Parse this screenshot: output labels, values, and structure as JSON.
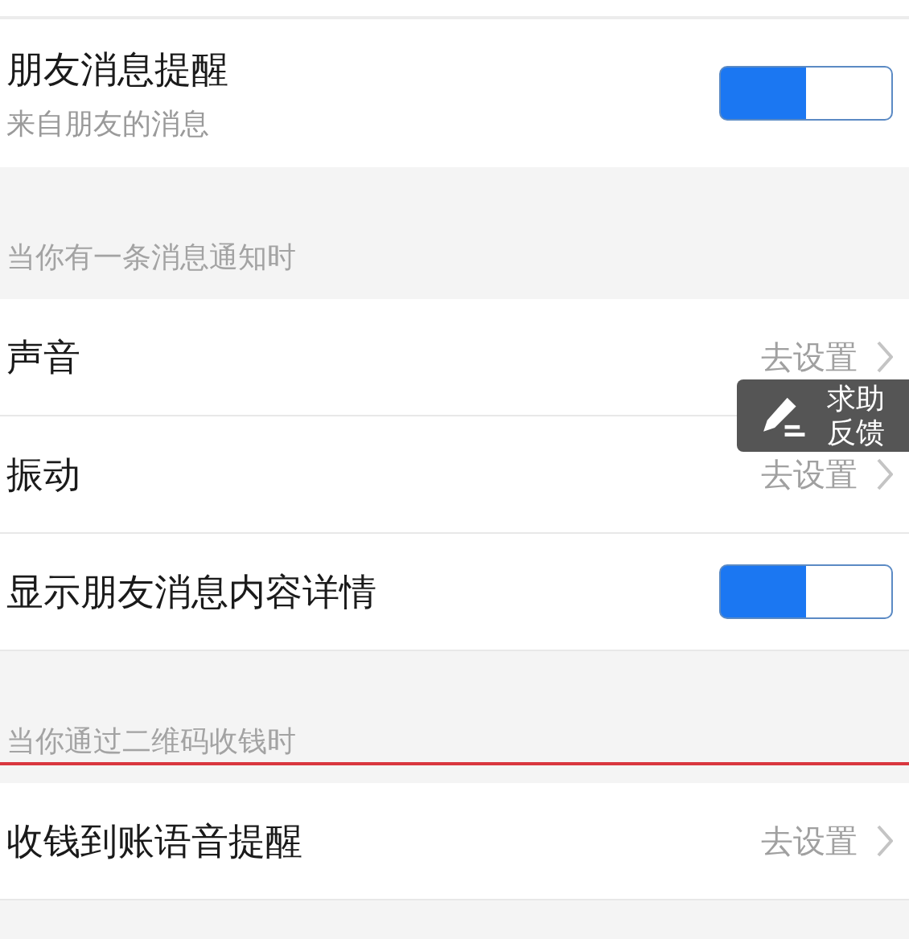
{
  "sections": [
    {
      "rows": [
        {
          "kind": "toggle",
          "title": "朋友消息提醒",
          "subtitle": "来自朋友的消息",
          "on": true
        }
      ]
    },
    {
      "header": "当你有一条消息通知时",
      "rows": [
        {
          "kind": "link",
          "title": "声音",
          "action": "去设置"
        },
        {
          "kind": "link",
          "title": "振动",
          "action": "去设置"
        },
        {
          "kind": "toggle",
          "title": "显示朋友消息内容详情",
          "on": true
        }
      ]
    },
    {
      "header": "当你通过二维码收钱时",
      "struck": true,
      "rows": [
        {
          "kind": "link",
          "title": "收钱到账语音提醒",
          "action": "去设置"
        }
      ]
    }
  ],
  "feedback_button": {
    "labels": [
      "求助",
      "反馈"
    ]
  }
}
